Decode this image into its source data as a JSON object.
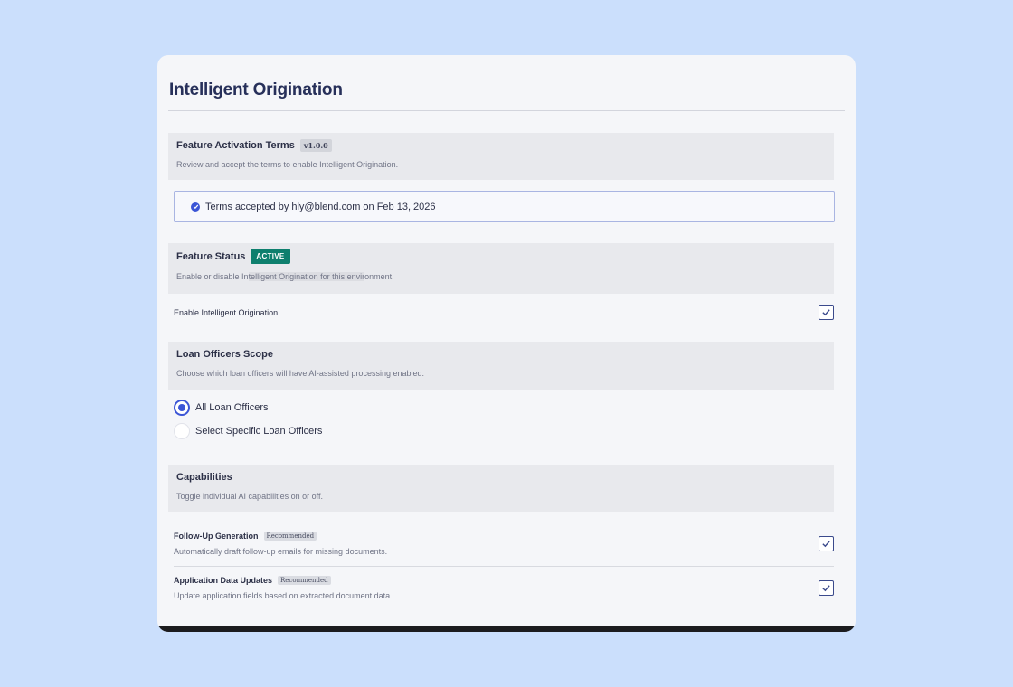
{
  "page": {
    "title": "Intelligent Origination"
  },
  "terms": {
    "title": "Feature Activation Terms",
    "version": "v1.0.0",
    "description": "Review and accept the terms to enable Intelligent Origination.",
    "accepted_text": "Terms accepted by hly@blend.com on Feb 13, 2026"
  },
  "status": {
    "title": "Feature Status",
    "badge": "ACTIVE",
    "description_start": "Enable or disable In",
    "description_highlight": "telligent Origination for this envir",
    "description_end": "onment.",
    "toggle_label": "Enable Intelligent Origination",
    "toggle_checked": true
  },
  "scope": {
    "title": "Loan Officers Scope",
    "description": "Choose which loan officers will have AI-assisted processing enabled.",
    "options": [
      {
        "label": "All Loan Officers",
        "selected": true
      },
      {
        "label": "Select Specific Loan Officers",
        "selected": false
      }
    ]
  },
  "capabilities": {
    "title": "Capabilities",
    "description": "Toggle individual AI capabilities on or off.",
    "items": [
      {
        "title": "Follow-Up Generation",
        "badge": "Recommended",
        "description": "Automatically draft follow-up emails for missing documents.",
        "checked": true
      },
      {
        "title": "Application Data Updates",
        "badge": "Recommended",
        "description": "Update application fields based on extracted document data.",
        "checked": true
      }
    ]
  },
  "colors": {
    "accent": "#3b55d6",
    "active_badge": "#0e7f6e",
    "background": "#cbdffc"
  }
}
